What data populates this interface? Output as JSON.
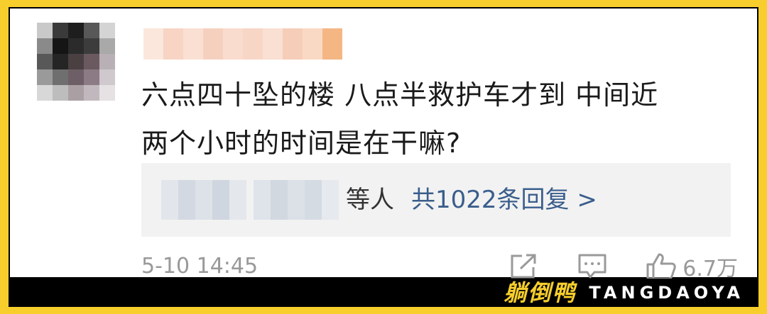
{
  "comment": {
    "line1": "六点四十坠的楼 八点半救护车才到 中间近",
    "line2": "两个小时的时间是在干嘛?"
  },
  "replies": {
    "and_others": "等人",
    "count_link": "共1022条回复 >"
  },
  "footer": {
    "timestamp": "5-10 14:45",
    "like_count": "6.7万",
    "icons": [
      "share-icon",
      "comment-icon",
      "thumb-up-icon"
    ]
  },
  "brand": {
    "cn": "躺倒鸭",
    "en": "TANGDAOYA"
  },
  "colors": {
    "frame": "#f7ce2c",
    "link": "#3a5e8c",
    "muted": "#999999",
    "reply_bg": "#f2f2f2"
  }
}
